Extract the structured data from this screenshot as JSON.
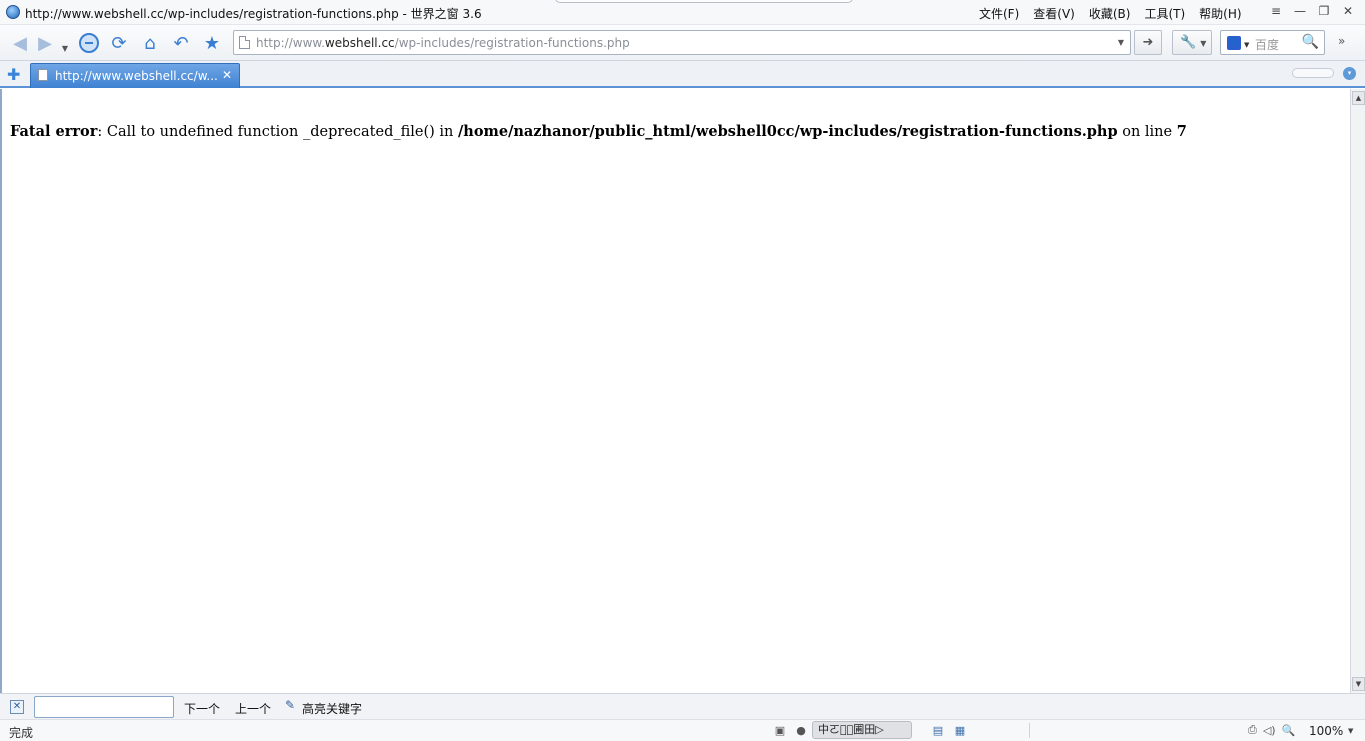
{
  "window": {
    "title": "http://www.webshell.cc/wp-includes/registration-functions.php - 世界之窗 3.6",
    "app_icon": "globe-icon"
  },
  "menu": {
    "items": [
      "文件(F)",
      "查看(V)",
      "收藏(B)",
      "工具(T)",
      "帮助(H)"
    ]
  },
  "window_controls": {
    "list": "≡",
    "minimize": "—",
    "restore": "❐",
    "close": "✕"
  },
  "toolbar": {
    "back": "◀",
    "forward": "▶",
    "history": "▼",
    "refresh": "⟳",
    "home": "⌂",
    "undo": "↶",
    "favorite": "★",
    "address_host_prefix": "http://www.",
    "address_host": "webshell.cc",
    "address_path": "/wp-includes/registration-functions.php",
    "address_drop": "▼",
    "go": "➜",
    "tools": "🔧",
    "tools_drop": "▼",
    "search_engine": "🐾",
    "search_placeholder": "百度",
    "search_icon": "🔍",
    "more": "»"
  },
  "tabs": {
    "new_tab": "✚",
    "items": [
      {
        "title": "http://www.webshell.cc/w...",
        "close": "✕"
      }
    ],
    "menu": "▾"
  },
  "content": {
    "error_label": "Fatal error",
    "message": ": Call to undefined function _deprecated_file() in ",
    "path": "/home/nazhanor/public_html/webshell0cc/wp-includes/registration-functions.php",
    "on_line": " on line ",
    "line": "7"
  },
  "scrollbar": {
    "up": "▲",
    "down": "▼"
  },
  "findbar": {
    "close": "✕",
    "next_label": "下一个",
    "prev_label": "上一个",
    "highlight_label": "高亮关键字",
    "input_value": ""
  },
  "statusbar": {
    "status": "完成",
    "ime_text": "中ㄛ载᷊圃田▷",
    "zoom": "100%",
    "zoom_drop": "▼"
  },
  "colors": {
    "accent": "#3f82d2",
    "tab_border": "#5b93d6"
  }
}
